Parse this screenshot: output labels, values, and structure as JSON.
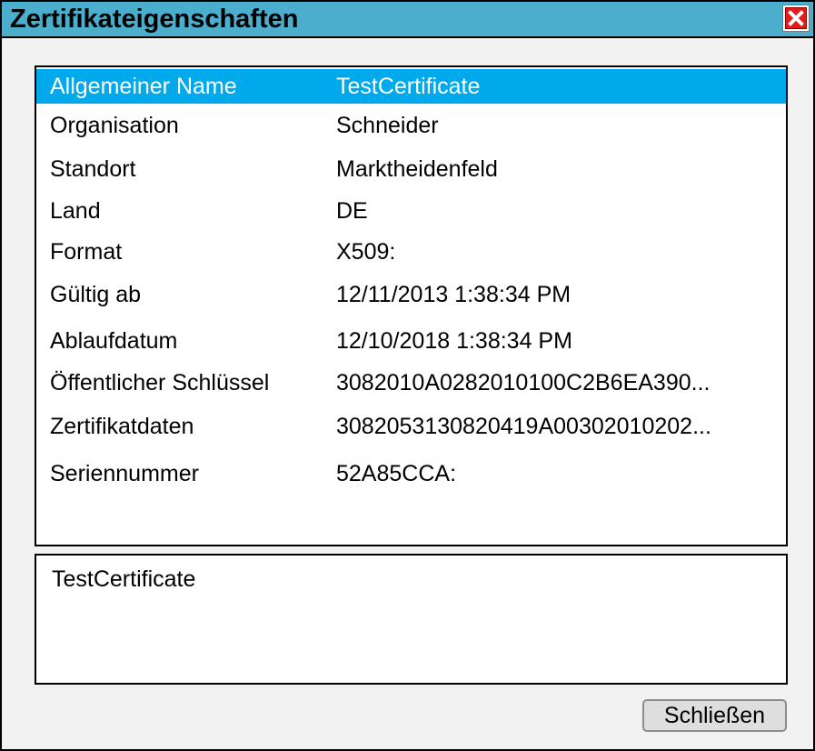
{
  "window": {
    "title": "Zertifikateigenschaften"
  },
  "properties": [
    {
      "label": "Allgemeiner Name",
      "value": "TestCertificate",
      "selected": true
    },
    {
      "label": "Organisation",
      "value": "Schneider",
      "selected": false
    },
    {
      "label": "Standort",
      "value": "Marktheidenfeld",
      "selected": false
    },
    {
      "label": "Land",
      "value": "DE",
      "selected": false
    },
    {
      "label": "Format",
      "value": "X509:",
      "selected": false
    },
    {
      "label": "Gültig ab",
      "value": "12/11/2013 1:38:34 PM",
      "selected": false
    },
    {
      "label": "Ablaufdatum",
      "value": "12/10/2018 1:38:34 PM",
      "selected": false
    },
    {
      "label": "Öffentlicher Schlüssel",
      "value": "3082010A0282010100C2B6EA390...",
      "selected": false
    },
    {
      "label": "Zertifikatdaten",
      "value": "3082053130820419A00302010202...",
      "selected": false
    },
    {
      "label": "Seriennummer",
      "value": "52A85CCA:",
      "selected": false
    }
  ],
  "detail": {
    "text": "TestCertificate"
  },
  "buttons": {
    "close_label": "Schließen"
  },
  "colors": {
    "titlebar": "#4aaecc",
    "selection": "#00a8ec",
    "close_icon": "#e31b1b"
  },
  "icons": {
    "close": "close-icon"
  }
}
